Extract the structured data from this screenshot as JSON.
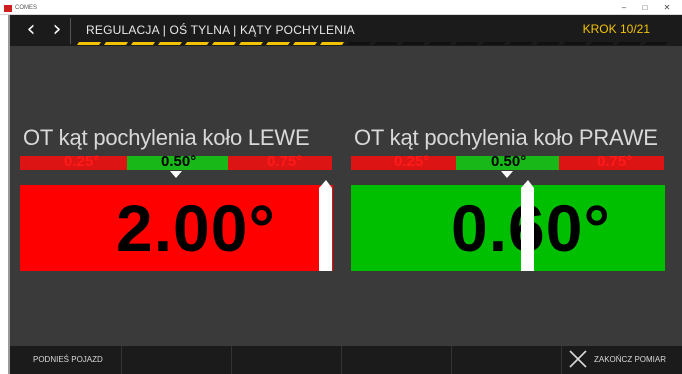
{
  "window": {
    "title": "COMES",
    "minimize_glyph": "–",
    "maximize_glyph": "□",
    "close_glyph": "✕"
  },
  "header": {
    "back_glyph": "‹",
    "forward_glyph": "›",
    "breadcrumb": "REGULACJA | OŚ TYLNA | KĄTY POCHYLENIA",
    "step": "KROK 10/21",
    "progress": {
      "current_step": 10,
      "total_steps": 21
    }
  },
  "colors": {
    "accent": "#f2c200",
    "out_of_range": "#ff0000",
    "in_range": "#00bf00",
    "scale_red": "#dd1414",
    "scale_green": "#18b818",
    "progress_inactive": "#111111"
  },
  "gauges": [
    {
      "title": "OT kąt pochylenia koło LEWE",
      "scale_labels": [
        "0.25°",
        "0.50°",
        "0.75°"
      ],
      "value": "2.00°",
      "status": "out_of_range"
    },
    {
      "title": "OT kąt pochylenia koło PRAWE",
      "scale_labels": [
        "0.25°",
        "0.50°",
        "0.75°"
      ],
      "value": "0.60°",
      "status": "in_range"
    }
  ],
  "footer": {
    "lift_label": "PODNIEŚ POJAZD",
    "finish_label": "ZAKOŃCZ POMIAR"
  },
  "icons": {
    "app": "app-icon",
    "back": "chevron-left-icon",
    "forward": "chevron-right-icon",
    "finish": "close-icon"
  }
}
